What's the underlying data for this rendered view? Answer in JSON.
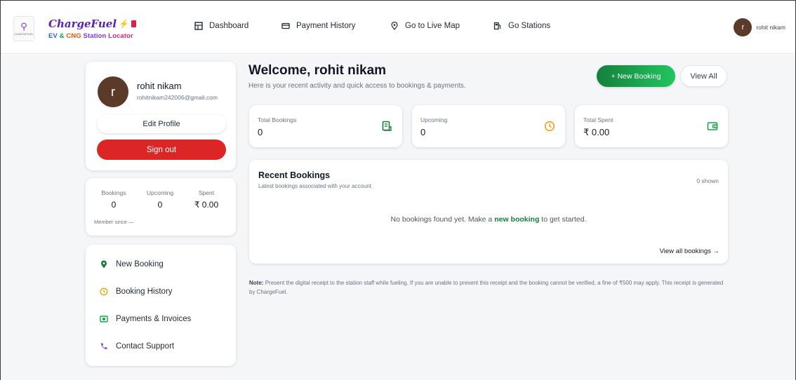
{
  "header": {
    "logo_text": "CHARGEFUEL",
    "brand_name": "ChargeFuel",
    "brand_sub": {
      "ev": "EV",
      "amp": "&",
      "cng": "CNG",
      "station": "Station",
      "locator": "Locator"
    },
    "nav": [
      {
        "label": "Dashboard",
        "icon": "dashboard-icon"
      },
      {
        "label": "Payment History",
        "icon": "card-icon"
      },
      {
        "label": "Go to Live Map",
        "icon": "map-pin-icon"
      },
      {
        "label": "Go Stations",
        "icon": "fuel-pump-icon"
      }
    ],
    "user": {
      "initial": "r",
      "name": "rohit nikam"
    }
  },
  "profile": {
    "initial": "r",
    "name": "rohit nikam",
    "email": "rohitnikam242006@gmail.com",
    "edit_label": "Edit Profile",
    "signout_label": "Sign out"
  },
  "quick_stats": {
    "bookings_label": "Bookings",
    "bookings_value": "0",
    "upcoming_label": "Upcoming",
    "upcoming_value": "0",
    "spent_label": "Spent",
    "spent_value": "₹ 0.00",
    "member_since": "Member since —"
  },
  "sidebar": {
    "items": [
      {
        "label": "New Booking",
        "icon": "location-pin-icon",
        "color": "#15803d"
      },
      {
        "label": "Booking History",
        "icon": "clock-icon",
        "color": "#f59e0b"
      },
      {
        "label": "Payments & Invoices",
        "icon": "invoice-icon",
        "color": "#16a34a"
      },
      {
        "label": "Contact Support",
        "icon": "phone-icon",
        "color": "#7c3aed"
      }
    ]
  },
  "main": {
    "welcome_title": "Welcome, rohit nikam",
    "welcome_sub": "Here is your recent activity and quick access to bookings & payments.",
    "new_booking_label": "+ New Booking",
    "view_all_label": "View All",
    "stats": [
      {
        "label": "Total Bookings",
        "value": "0",
        "icon": "receipt-icon",
        "color": "#15803d"
      },
      {
        "label": "Upcoming",
        "value": "0",
        "icon": "clock-icon",
        "color": "#f59e0b"
      },
      {
        "label": "Total Spent",
        "value": "₹ 0.00",
        "icon": "wallet-icon",
        "color": "#16a34a"
      }
    ],
    "recent": {
      "title": "Recent Bookings",
      "subtitle": "Latest bookings associated with your account",
      "count": "0 shown",
      "empty_prefix": "No bookings found yet. Make a ",
      "empty_link": "new booking",
      "empty_suffix": " to get started.",
      "view_all_link": "View all bookings →"
    },
    "note_label": "Note:",
    "note_text": "Present the digital receipt to the station staff while fueling. If you are unable to present this receipt and the booking cannot be verified, a fine of ₹500 may apply. This receipt is generated by ChargeFuel."
  }
}
